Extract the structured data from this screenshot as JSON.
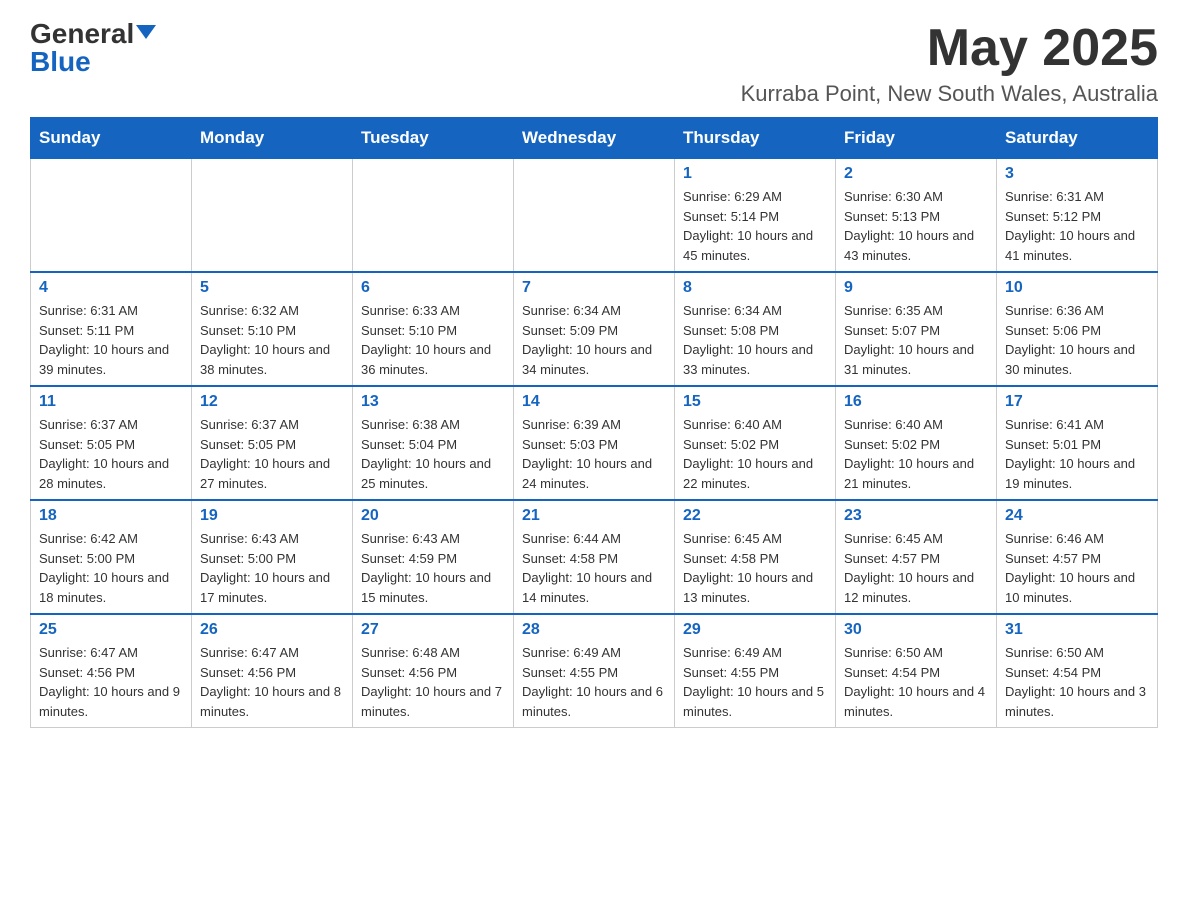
{
  "header": {
    "logo_general": "General",
    "logo_blue": "Blue",
    "month_title": "May 2025",
    "location": "Kurraba Point, New South Wales, Australia"
  },
  "days_of_week": [
    "Sunday",
    "Monday",
    "Tuesday",
    "Wednesday",
    "Thursday",
    "Friday",
    "Saturday"
  ],
  "weeks": [
    [
      {
        "day": "",
        "info": ""
      },
      {
        "day": "",
        "info": ""
      },
      {
        "day": "",
        "info": ""
      },
      {
        "day": "",
        "info": ""
      },
      {
        "day": "1",
        "info": "Sunrise: 6:29 AM\nSunset: 5:14 PM\nDaylight: 10 hours and 45 minutes."
      },
      {
        "day": "2",
        "info": "Sunrise: 6:30 AM\nSunset: 5:13 PM\nDaylight: 10 hours and 43 minutes."
      },
      {
        "day": "3",
        "info": "Sunrise: 6:31 AM\nSunset: 5:12 PM\nDaylight: 10 hours and 41 minutes."
      }
    ],
    [
      {
        "day": "4",
        "info": "Sunrise: 6:31 AM\nSunset: 5:11 PM\nDaylight: 10 hours and 39 minutes."
      },
      {
        "day": "5",
        "info": "Sunrise: 6:32 AM\nSunset: 5:10 PM\nDaylight: 10 hours and 38 minutes."
      },
      {
        "day": "6",
        "info": "Sunrise: 6:33 AM\nSunset: 5:10 PM\nDaylight: 10 hours and 36 minutes."
      },
      {
        "day": "7",
        "info": "Sunrise: 6:34 AM\nSunset: 5:09 PM\nDaylight: 10 hours and 34 minutes."
      },
      {
        "day": "8",
        "info": "Sunrise: 6:34 AM\nSunset: 5:08 PM\nDaylight: 10 hours and 33 minutes."
      },
      {
        "day": "9",
        "info": "Sunrise: 6:35 AM\nSunset: 5:07 PM\nDaylight: 10 hours and 31 minutes."
      },
      {
        "day": "10",
        "info": "Sunrise: 6:36 AM\nSunset: 5:06 PM\nDaylight: 10 hours and 30 minutes."
      }
    ],
    [
      {
        "day": "11",
        "info": "Sunrise: 6:37 AM\nSunset: 5:05 PM\nDaylight: 10 hours and 28 minutes."
      },
      {
        "day": "12",
        "info": "Sunrise: 6:37 AM\nSunset: 5:05 PM\nDaylight: 10 hours and 27 minutes."
      },
      {
        "day": "13",
        "info": "Sunrise: 6:38 AM\nSunset: 5:04 PM\nDaylight: 10 hours and 25 minutes."
      },
      {
        "day": "14",
        "info": "Sunrise: 6:39 AM\nSunset: 5:03 PM\nDaylight: 10 hours and 24 minutes."
      },
      {
        "day": "15",
        "info": "Sunrise: 6:40 AM\nSunset: 5:02 PM\nDaylight: 10 hours and 22 minutes."
      },
      {
        "day": "16",
        "info": "Sunrise: 6:40 AM\nSunset: 5:02 PM\nDaylight: 10 hours and 21 minutes."
      },
      {
        "day": "17",
        "info": "Sunrise: 6:41 AM\nSunset: 5:01 PM\nDaylight: 10 hours and 19 minutes."
      }
    ],
    [
      {
        "day": "18",
        "info": "Sunrise: 6:42 AM\nSunset: 5:00 PM\nDaylight: 10 hours and 18 minutes."
      },
      {
        "day": "19",
        "info": "Sunrise: 6:43 AM\nSunset: 5:00 PM\nDaylight: 10 hours and 17 minutes."
      },
      {
        "day": "20",
        "info": "Sunrise: 6:43 AM\nSunset: 4:59 PM\nDaylight: 10 hours and 15 minutes."
      },
      {
        "day": "21",
        "info": "Sunrise: 6:44 AM\nSunset: 4:58 PM\nDaylight: 10 hours and 14 minutes."
      },
      {
        "day": "22",
        "info": "Sunrise: 6:45 AM\nSunset: 4:58 PM\nDaylight: 10 hours and 13 minutes."
      },
      {
        "day": "23",
        "info": "Sunrise: 6:45 AM\nSunset: 4:57 PM\nDaylight: 10 hours and 12 minutes."
      },
      {
        "day": "24",
        "info": "Sunrise: 6:46 AM\nSunset: 4:57 PM\nDaylight: 10 hours and 10 minutes."
      }
    ],
    [
      {
        "day": "25",
        "info": "Sunrise: 6:47 AM\nSunset: 4:56 PM\nDaylight: 10 hours and 9 minutes."
      },
      {
        "day": "26",
        "info": "Sunrise: 6:47 AM\nSunset: 4:56 PM\nDaylight: 10 hours and 8 minutes."
      },
      {
        "day": "27",
        "info": "Sunrise: 6:48 AM\nSunset: 4:56 PM\nDaylight: 10 hours and 7 minutes."
      },
      {
        "day": "28",
        "info": "Sunrise: 6:49 AM\nSunset: 4:55 PM\nDaylight: 10 hours and 6 minutes."
      },
      {
        "day": "29",
        "info": "Sunrise: 6:49 AM\nSunset: 4:55 PM\nDaylight: 10 hours and 5 minutes."
      },
      {
        "day": "30",
        "info": "Sunrise: 6:50 AM\nSunset: 4:54 PM\nDaylight: 10 hours and 4 minutes."
      },
      {
        "day": "31",
        "info": "Sunrise: 6:50 AM\nSunset: 4:54 PM\nDaylight: 10 hours and 3 minutes."
      }
    ]
  ]
}
